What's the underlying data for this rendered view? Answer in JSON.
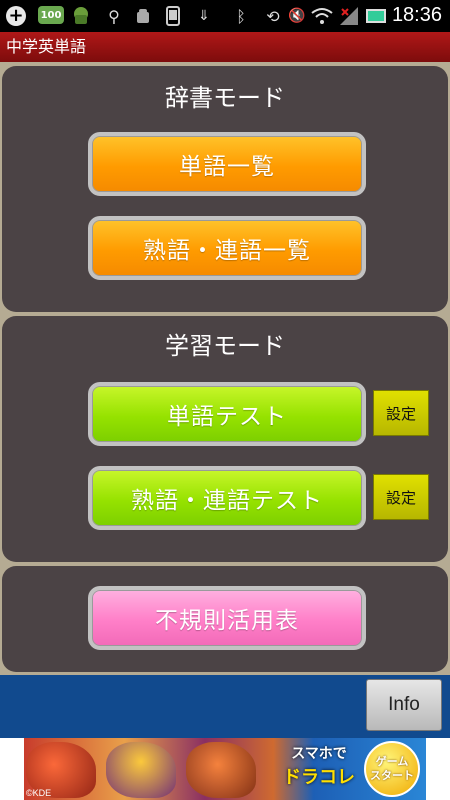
{
  "status_bar": {
    "battery_badge": "100",
    "time": "18:36",
    "icons": [
      "add-icon",
      "battery-100-icon",
      "android-icon",
      "usb-icon",
      "android-debug-icon",
      "phone-icon",
      "download-icon",
      "bluetooth-icon",
      "rotate-icon",
      "mute-icon",
      "wifi-icon",
      "signal-icon",
      "battery-icon"
    ]
  },
  "app": {
    "title": "中学英単語"
  },
  "dictionary_mode": {
    "title": "辞書モード",
    "word_list_label": "単語一覧",
    "idiom_list_label": "熟語・連語一覧"
  },
  "study_mode": {
    "title": "学習モード",
    "word_test_label": "単語テスト",
    "word_test_settings_label": "設定",
    "idiom_test_label": "熟語・連語テスト",
    "idiom_test_settings_label": "設定"
  },
  "irregular": {
    "label": "不規則活用表"
  },
  "bottom_bar": {
    "info_label": "Info"
  },
  "ad": {
    "text_line1": "スマホで",
    "text_line2": "ドラコレ",
    "start_label": "ゲーム\nスタート",
    "copyright": "©KDE"
  },
  "colors": {
    "title_bar": "#9a1010",
    "panel": "#4b4345",
    "orange_button": "#ff9b00",
    "green_button": "#96e200",
    "pink_button": "#ff7fc8",
    "settings_button": "#c8c800",
    "bottom_bar": "#114a8e"
  }
}
